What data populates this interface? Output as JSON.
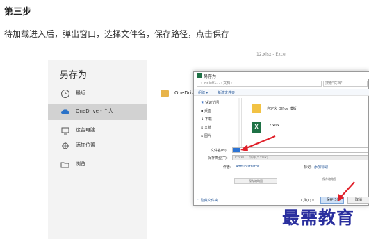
{
  "step": {
    "title": "第三步",
    "description": "待加载进入后，弹出窗口，选择文件名，保存路径，点击保存"
  },
  "window_title": "12.xlsx - Excel",
  "backstage": {
    "heading": "另存为",
    "items": [
      {
        "label": "最近",
        "icon": "clock-icon"
      },
      {
        "label": "OneDrive - 个人",
        "icon": "cloud-icon"
      },
      {
        "label": "这台电脑",
        "icon": "computer-icon"
      },
      {
        "label": "添加位置",
        "icon": "add-location-icon"
      },
      {
        "label": "浏览",
        "icon": "folder-open-icon"
      }
    ],
    "right_folder": "OneDrive"
  },
  "dialog": {
    "title": "另存为",
    "address": "« Indie01... › 文档 ›",
    "search_placeholder": "搜索\"文档\"",
    "toolbar": {
      "organize": "组织 ▾",
      "new_folder": "新建文件夹"
    },
    "nav_items": [
      "快速访问",
      "桌面",
      "下载",
      "文档",
      "图片"
    ],
    "files": [
      {
        "name": "自定义 Office 模板",
        "type": "folder"
      },
      {
        "name": "12.xlsx",
        "type": "excel"
      }
    ],
    "filename_label": "文件名(N):",
    "filetype_label": "保存类型(T):",
    "filetype_value": "Excel 工作簿(*.xlsx)",
    "author_label": "作者:",
    "author_value": "Administrator",
    "tags_label": "标记:",
    "tags_value": "添加标记",
    "thumbnail_button": "保存缩略图",
    "hide_folders": "^ 隐藏文件夹",
    "tools": "工具(L) ▾",
    "save_button": "保存(S)",
    "cancel_button": "取消"
  },
  "watermark": "最需教育",
  "colors": {
    "arrow_red": "#e0202a",
    "selection_blue": "#2b73d4",
    "watermark_blue": "#2a2f9e",
    "excel_green": "#1e7145"
  }
}
